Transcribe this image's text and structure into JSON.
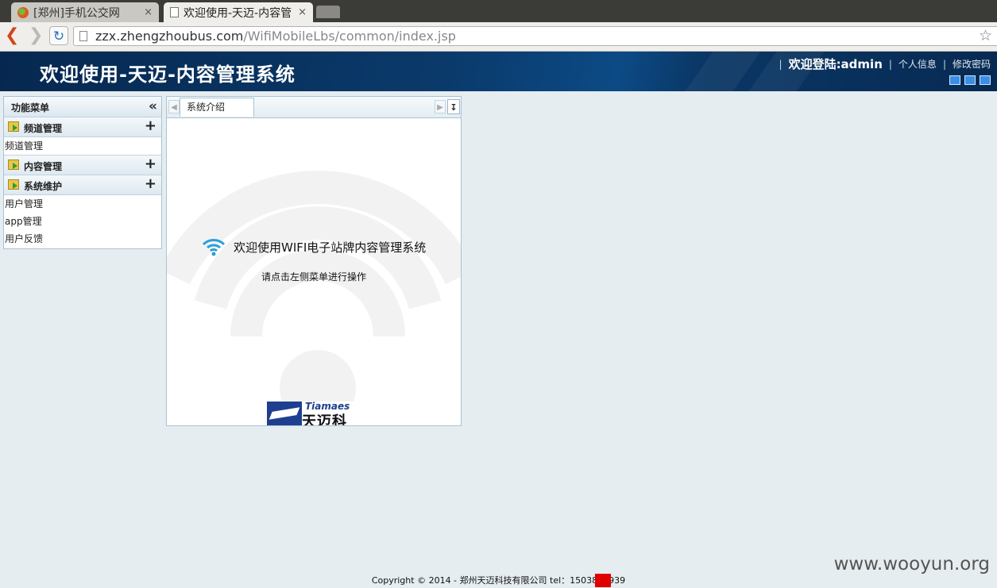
{
  "browser": {
    "tabs": [
      {
        "title": "[郑州]手机公交网",
        "active": false
      },
      {
        "title": "欢迎使用-天迈-内容管",
        "active": true
      }
    ],
    "close_glyph": "×",
    "url_host": "zzx.zhengzhoubus.com",
    "url_path": "/WifiMobileLbs/common/index.jsp"
  },
  "header": {
    "title": "欢迎使用-天迈-内容管理系统",
    "welcome": "欢迎登陆:admin",
    "links": [
      "个人信息",
      "修改密码"
    ],
    "theme_colors": [
      "#3a8ee6",
      "#3a8ee6",
      "#3a8ee6"
    ]
  },
  "sidebar": {
    "title": "功能菜单",
    "groups": [
      {
        "label": "频道管理",
        "items": [
          "频道管理"
        ]
      },
      {
        "label": "内容管理",
        "items": []
      },
      {
        "label": "系统维护",
        "items": [
          "用户管理",
          "app管理",
          "用户反馈"
        ]
      }
    ]
  },
  "main": {
    "tab_label": "系统介绍",
    "welcome_text": "欢迎使用WIFI电子站牌内容管理系统",
    "hint_text": "请点击左侧菜单进行操作",
    "logo_en": "Tiamaes",
    "logo_cn": "天迈科技"
  },
  "footer": {
    "text_before": "Copyright © 2014 - 郑州天迈科技有限公司 tel：15038",
    "text_after": "939"
  },
  "watermark": "www.wooyun.org"
}
